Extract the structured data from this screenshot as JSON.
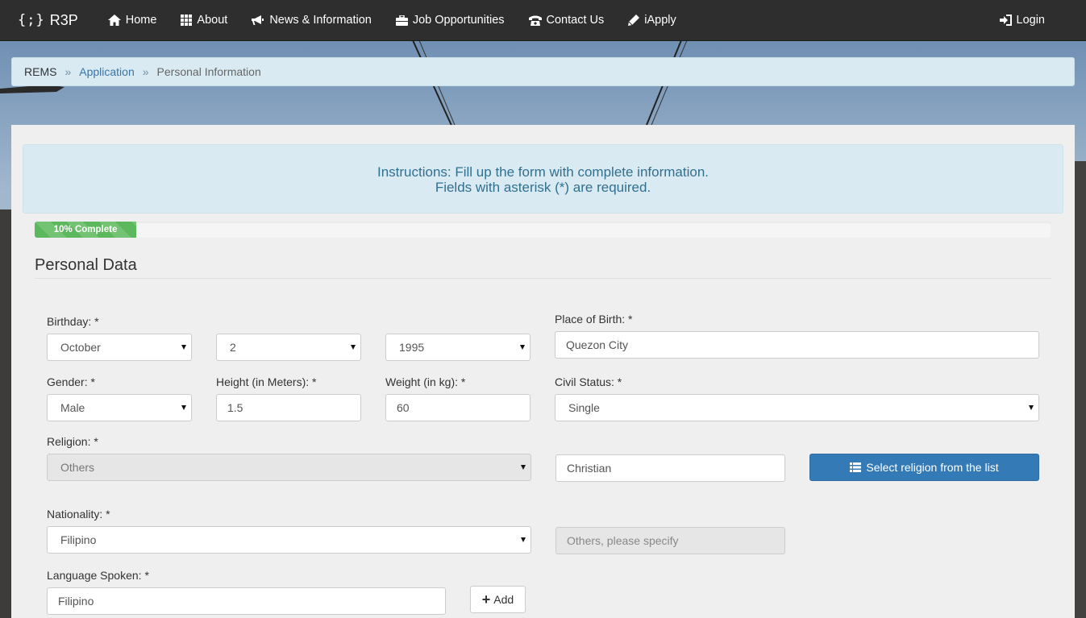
{
  "navbar": {
    "brand_logo": "{;}",
    "brand_name": "R3P",
    "items": [
      {
        "label": "Home",
        "icon": "home-icon"
      },
      {
        "label": "About",
        "icon": "grid-icon"
      },
      {
        "label": "News & Information",
        "icon": "megaphone-icon"
      },
      {
        "label": "Job Opportunities",
        "icon": "briefcase-icon"
      },
      {
        "label": "Contact Us",
        "icon": "phone-icon"
      },
      {
        "label": "iApply",
        "icon": "pencil-icon"
      }
    ],
    "login": {
      "label": "Login",
      "icon": "login-icon"
    }
  },
  "breadcrumb": {
    "root": "REMS",
    "separator": "»",
    "link": "Application",
    "current": "Personal Information"
  },
  "instructions": {
    "line1": "Instructions: Fill up the form with complete information.",
    "line2": "Fields with asterisk (*) are required."
  },
  "progress": {
    "label": "10% Complete",
    "percent": 10
  },
  "section": {
    "title": "Personal Data"
  },
  "form": {
    "birthday": {
      "label": "Birthday: *",
      "month": "October",
      "day": "2",
      "year": "1995"
    },
    "place_of_birth": {
      "label": "Place of Birth: *",
      "value": "Quezon City"
    },
    "gender": {
      "label": "Gender: *",
      "value": "Male"
    },
    "height": {
      "label": "Height (in Meters): *",
      "value": "1.5"
    },
    "weight": {
      "label": "Weight (in kg): *",
      "value": "60"
    },
    "civil_status": {
      "label": "Civil Status: *",
      "value": "Single"
    },
    "religion": {
      "label": "Religion: *",
      "value": "Others",
      "other_value": "Christian",
      "select_button": "Select religion from the list"
    },
    "nationality": {
      "label": "Nationality: *",
      "value": "Filipino",
      "other_placeholder": "Others, please specify"
    },
    "language": {
      "label": "Language Spoken: *",
      "value": "Filipino",
      "add_button": "Add"
    }
  },
  "colors": {
    "navbar": "#2e2e2e",
    "breadcrumb_bg": "#d9eaf3",
    "info_text": "#31708f",
    "progress": "#5cb85c",
    "primary": "#337ab7"
  }
}
